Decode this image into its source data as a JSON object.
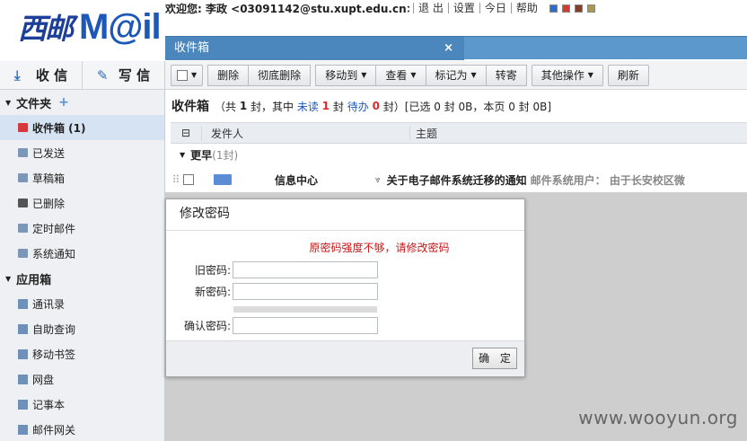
{
  "brand": {
    "logo_cal": "西邮",
    "logo_word": "M@il"
  },
  "topbar": {
    "welcome": "欢迎您: 李政 <03091142@stu.xupt.edu.cn>",
    "links": [
      "退 出",
      "设置",
      "今日",
      "帮助"
    ],
    "swatch_colors": [
      "#2a6fd0",
      "#d63b2e",
      "#8b3a24",
      "#a89a4a"
    ]
  },
  "tab": {
    "label": "收件箱",
    "close": "×"
  },
  "sidebar": {
    "receive": "收 信",
    "compose": "写 信",
    "folders_header": "文件夹",
    "folders": [
      {
        "label": "收件箱 (1)"
      },
      {
        "label": "已发送"
      },
      {
        "label": "草稿箱"
      },
      {
        "label": "已删除"
      },
      {
        "label": "定时邮件"
      },
      {
        "label": "系统通知"
      }
    ],
    "apps_header": "应用箱",
    "apps": [
      {
        "label": "通讯录"
      },
      {
        "label": "自助查询"
      },
      {
        "label": "移动书签"
      },
      {
        "label": "网盘"
      },
      {
        "label": "记事本"
      },
      {
        "label": "邮件网关"
      }
    ]
  },
  "toolbar": {
    "delete": "删除",
    "purge": "彻底删除",
    "move": "移动到",
    "view": "查看",
    "mark": "标记为",
    "forward": "转寄",
    "more": "其他操作",
    "refresh": "刷新"
  },
  "summary": {
    "title": "收件箱",
    "p1": "（共",
    "total": "1",
    "p2": "封，其中",
    "unread_label": "未读",
    "unread": "1",
    "p3": "封",
    "todo_label": "待办",
    "todo": "0",
    "p4": "封）[已选 0 封 0B，本页 0 封 0B]"
  },
  "table": {
    "col_from": "发件人",
    "col_subject": "主题",
    "group_label": "更早",
    "group_count": "(1封)",
    "rows": [
      {
        "from": "信息中心",
        "subject": "关于电子邮件系统迁移的通知",
        "preview": "邮件系统用户：  由于长安校区微"
      }
    ]
  },
  "dialog": {
    "title": "修改密码",
    "warning": "原密码强度不够，请修改密码",
    "old_label": "旧密码:",
    "new_label": "新密码:",
    "confirm_label": "确认密码:",
    "old_value": "",
    "new_value": "",
    "confirm_value": "",
    "ok": "确 定"
  },
  "watermark": "www.wooyun.org"
}
